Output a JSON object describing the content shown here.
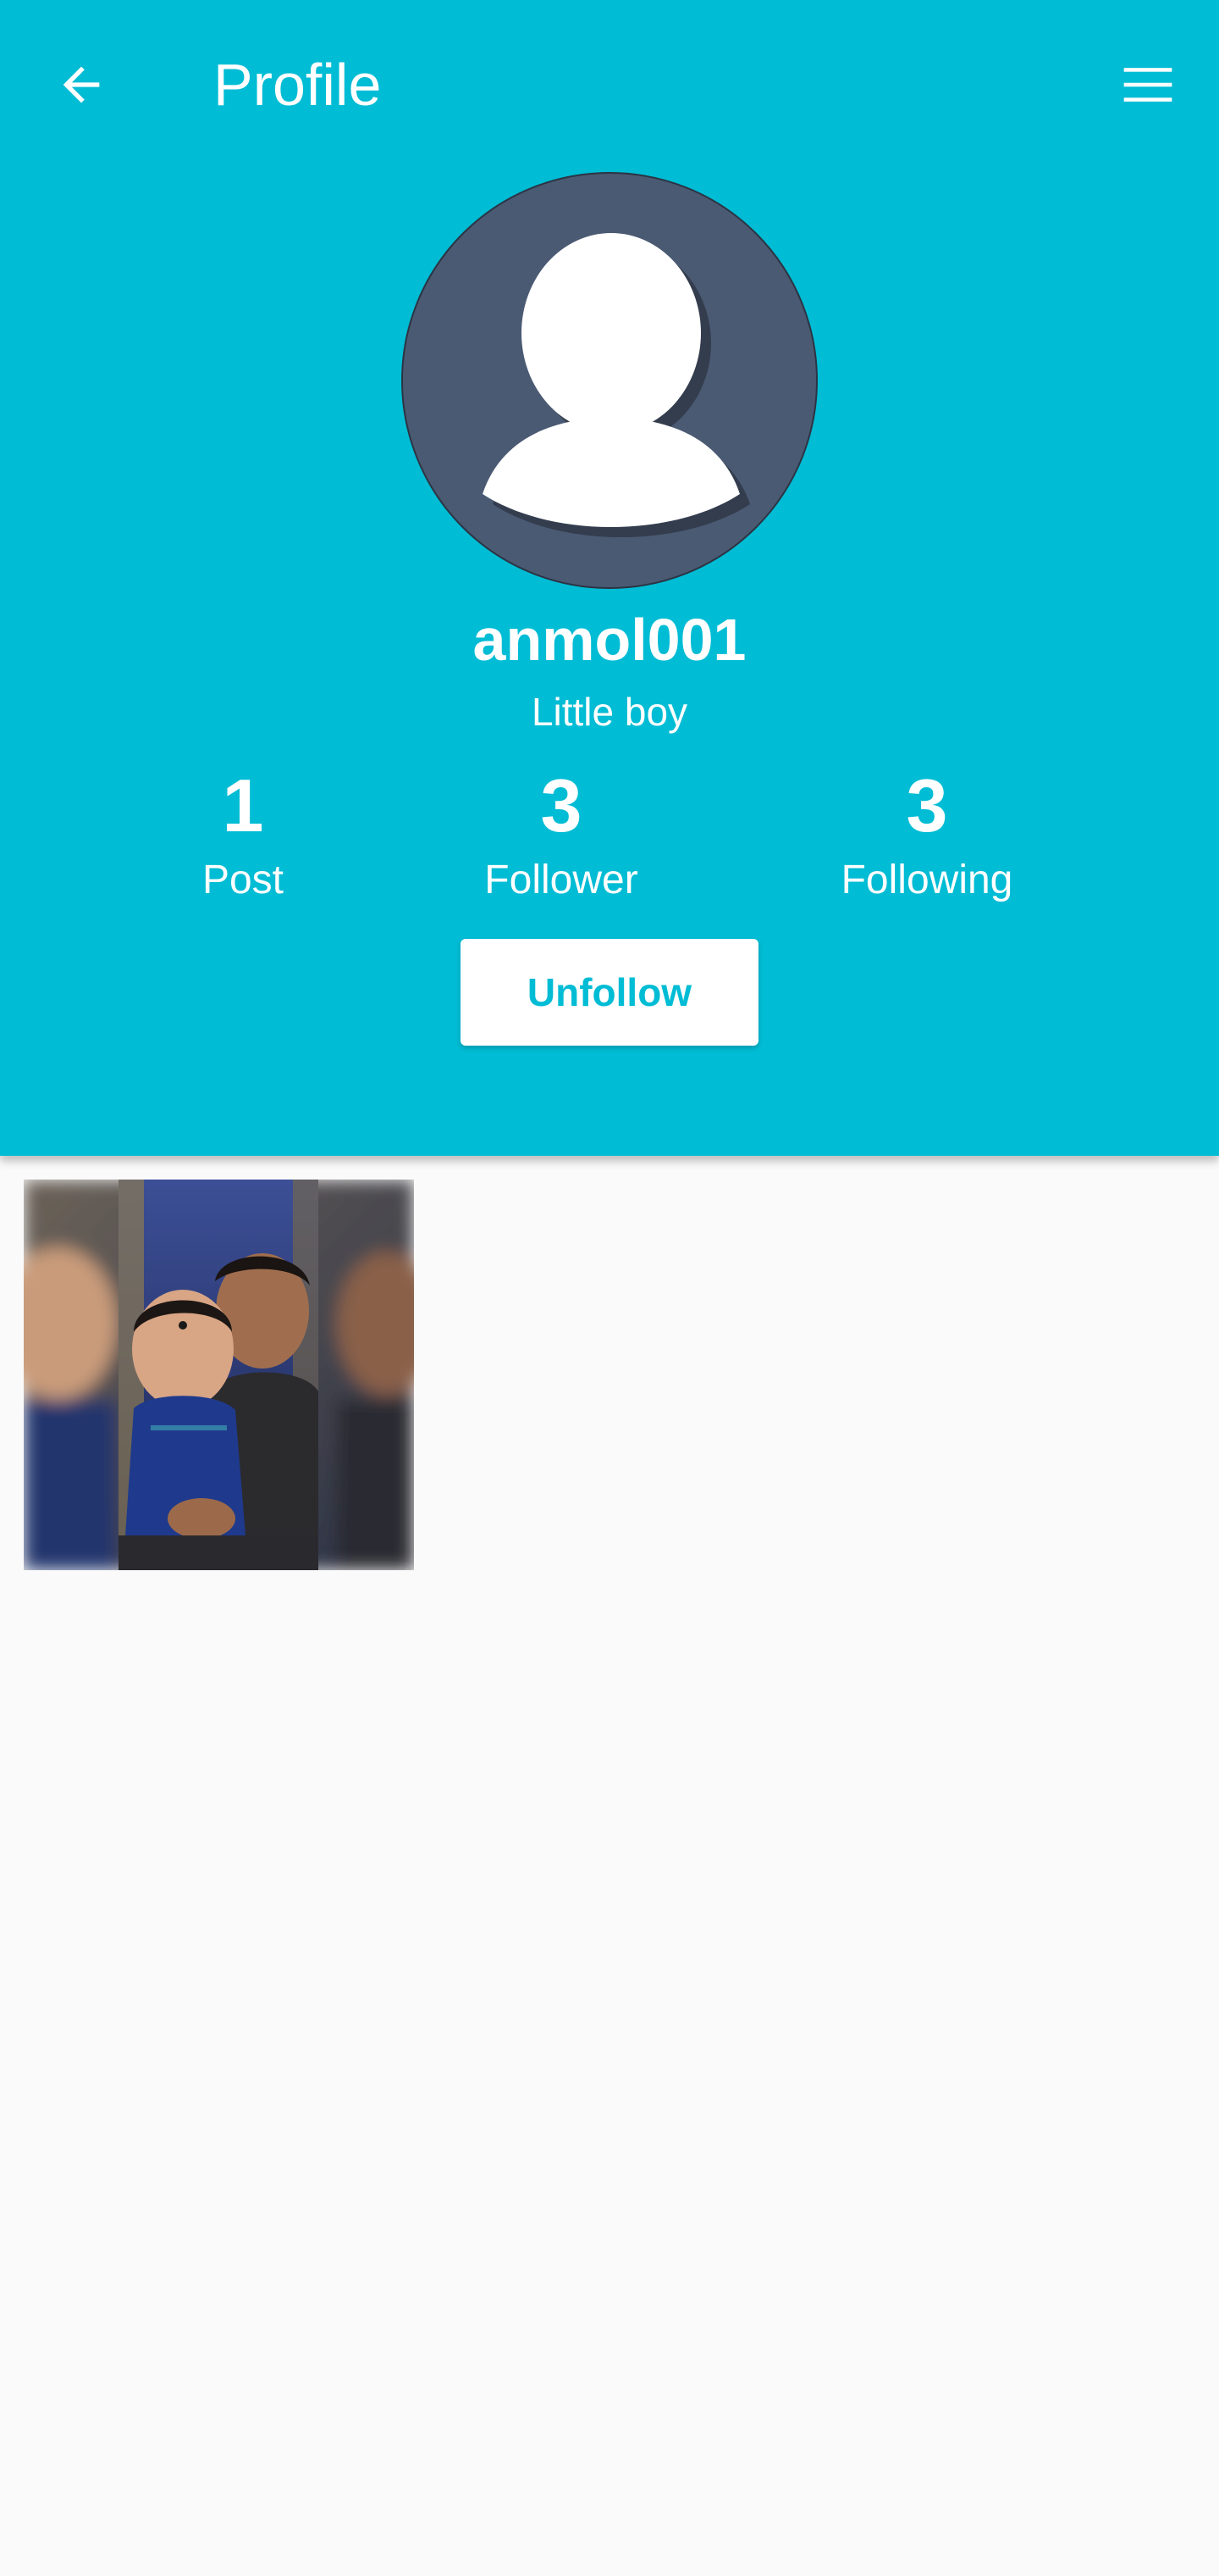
{
  "toolbar": {
    "title": "Profile",
    "back_icon": "arrow-left-icon",
    "menu_icon": "hamburger-menu-icon"
  },
  "profile": {
    "username": "anmol001",
    "bio": "Little boy",
    "avatar_icon": "default-user-avatar-icon",
    "stats": {
      "posts": {
        "value": "1",
        "label": "Post"
      },
      "followers": {
        "value": "3",
        "label": "Follower"
      },
      "following": {
        "value": "3",
        "label": "Following"
      }
    },
    "unfollow_label": "Unfollow"
  },
  "posts": [
    {
      "description": "photo-thumbnail"
    }
  ],
  "colors": {
    "primary": "#00bcd4",
    "avatar_bg": "#4b5a73",
    "page_bg": "#fafafa",
    "on_primary": "#ffffff"
  }
}
